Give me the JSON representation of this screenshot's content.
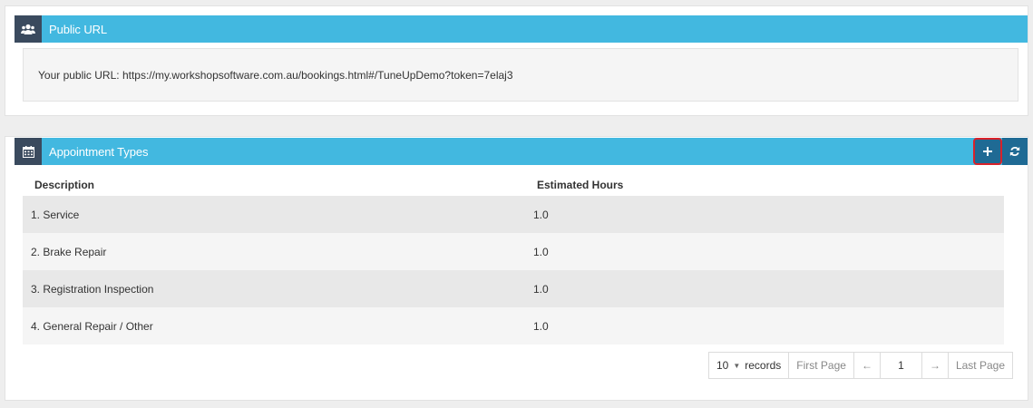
{
  "public_url_panel": {
    "title": "Public URL",
    "icon": "users-icon",
    "text": "Your public URL: https://my.workshopsoftware.com.au/bookings.html#/TuneUpDemo?token=7elaj3"
  },
  "appointment_panel": {
    "title": "Appointment Types",
    "icon": "calendar-icon",
    "add_icon": "plus-icon",
    "refresh_icon": "refresh-icon",
    "columns": {
      "description": "Description",
      "estimated_hours": "Estimated Hours"
    },
    "rows": [
      {
        "description": "1. Service",
        "hours": "1.0"
      },
      {
        "description": "2. Brake Repair",
        "hours": "1.0"
      },
      {
        "description": "3. Registration Inspection",
        "hours": "1.0"
      },
      {
        "description": "4. General Repair / Other",
        "hours": "1.0"
      }
    ]
  },
  "pagination": {
    "page_size": "10",
    "records_label": "records",
    "first_page": "First Page",
    "prev": "←",
    "current_page": "1",
    "next": "→",
    "last_page": "Last Page"
  },
  "colors": {
    "header": "#42b8e0",
    "icon_bg": "#3a4a5e",
    "action_bg": "#1f6a94",
    "highlight": "#d9222a"
  }
}
